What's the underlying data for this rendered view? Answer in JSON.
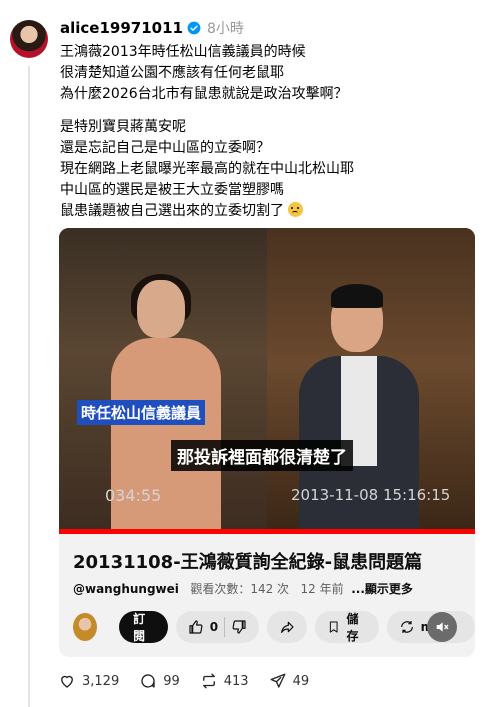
{
  "post": {
    "username": "alice19971011",
    "time": "8小時",
    "lines": [
      "王鴻薇2013年時任松山信義議員的時候",
      "很清楚知道公園不應該有任何老鼠耶",
      "為什麼2026台北市有鼠患就說是政治攻擊啊？",
      "是特別寶貝蔣萬安呢",
      "還是忘記自己是中山區的立委啊？",
      "現在網路上老鼠曝光率最高的就在中山北松山耶",
      "中山區的選民是被王大立委當塑膠嗎",
      "鼠患議題被自己選出來的立委切割了"
    ]
  },
  "video": {
    "caption_tag": "時任松山信義議員",
    "subtitle": "那投訴裡面都很清楚了",
    "time_left": "034:55",
    "time_right": "2013-11-08 15:16:15",
    "progress": 1.0,
    "progress_color": "#ff0000",
    "title": "20131108-王鴻薇質詢全紀錄-鼠患問題篇",
    "channel": "@wanghungwei",
    "views": "觀看次數：142 次",
    "age": "12 年前",
    "more": "...顯示更多",
    "subscribe_label": "訂閱",
    "like_count": "0",
    "save_label": "儲存",
    "remix_label": "mix"
  },
  "stats": {
    "likes": "3,129",
    "comments": "99",
    "reposts": "413",
    "shares": "49"
  },
  "colors": {
    "verified": "#0095f6",
    "caption_bg": "#1f4fbf"
  }
}
